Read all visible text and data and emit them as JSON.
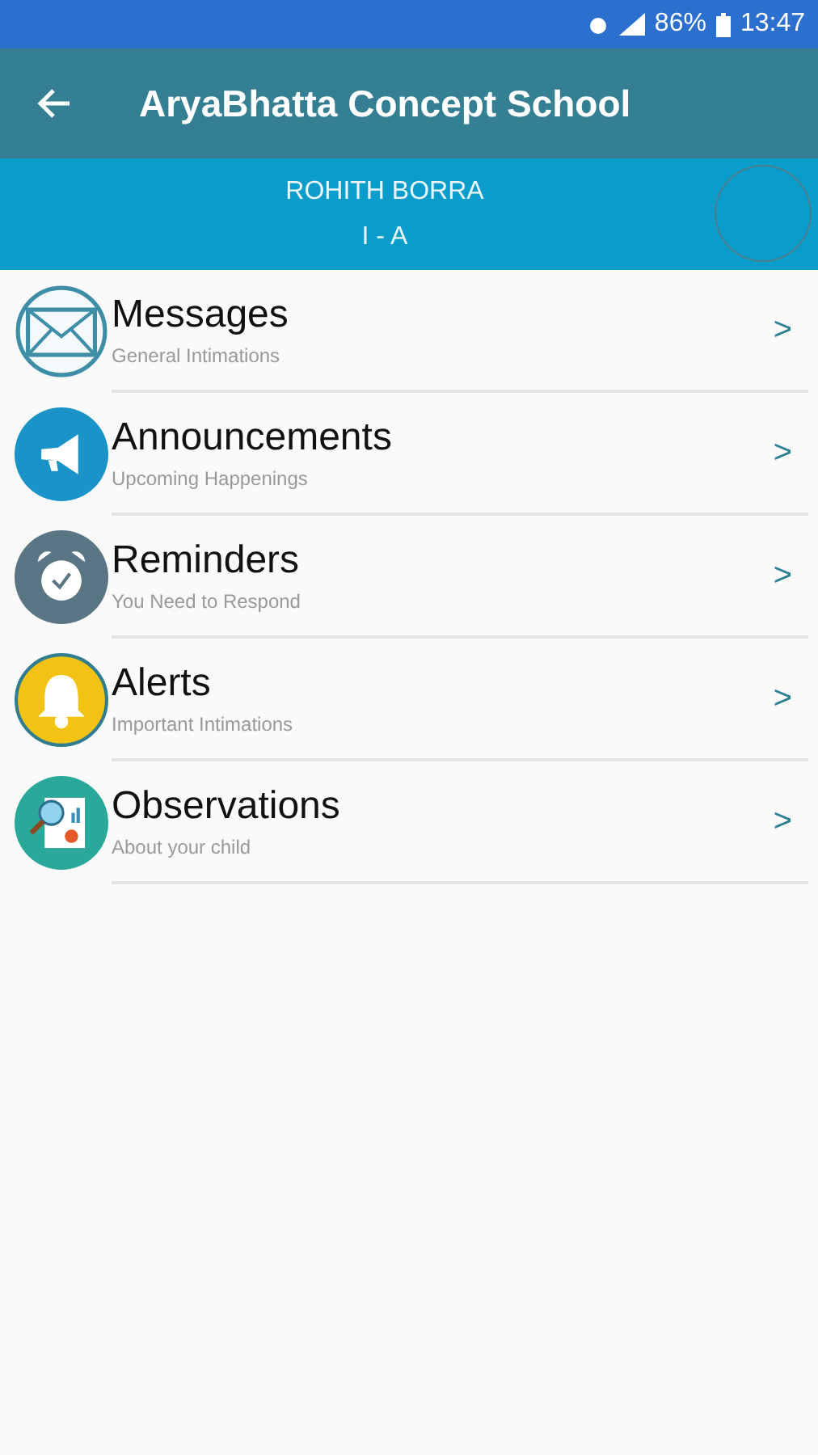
{
  "status_bar": {
    "battery": "86%",
    "time": "13:47"
  },
  "app_bar": {
    "title": "AryaBhatta Concept School"
  },
  "profile": {
    "name": "ROHITH  BORRA",
    "class": "I - A"
  },
  "menu": [
    {
      "kind": "messages",
      "title": "Messages",
      "subtitle": "General Intimations",
      "arrow": ">"
    },
    {
      "kind": "announcements",
      "title": "Announcements",
      "subtitle": "Upcoming Happenings",
      "arrow": ">"
    },
    {
      "kind": "reminders",
      "title": "Reminders",
      "subtitle": "You Need to Respond",
      "arrow": ">"
    },
    {
      "kind": "alerts",
      "title": "Alerts",
      "subtitle": "Important Intimations",
      "arrow": ">"
    },
    {
      "kind": "observations",
      "title": "Observations",
      "subtitle": "About your child",
      "arrow": ">"
    }
  ]
}
